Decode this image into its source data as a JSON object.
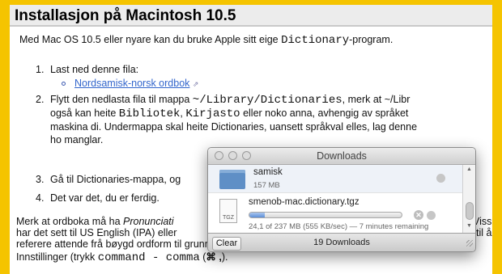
{
  "heading": "Installasjon på Macintosh 10.5",
  "intro": {
    "pre": "Med Mac OS 10.5 eller nyare kan du bruke Apple sitt eige ",
    "code": "Dictionary",
    "post": "-program."
  },
  "steps": {
    "n1": "1.",
    "s1": "Last ned denne fila:",
    "link": "Nordsamisk-norsk ordbok",
    "ext_icon": "external-link-icon",
    "n2": "2.",
    "s2a_pre": "Flytt den nedlasta fila til mappa ",
    "s2a_code": "~/Library/Dictionaries",
    "s2a_post": ", merk at ~/Libr",
    "s2b_pre": "også kan heite ",
    "s2b_code1": "Bibliotek",
    "s2b_sep": ", ",
    "s2b_code2": "Kirjasto",
    "s2b_post": " eller noko anna, avhengig av språket",
    "s2c": "maskina di. Undermappa skal heite Dictionaries, uansett språkval elles, lag denne",
    "s2d": "ho manglar.",
    "n3": "3.",
    "s3": "Gå til Dictionaries-mappa, og",
    "n4": "4.",
    "s4": "Det var det, du er ferdig."
  },
  "footer": {
    "l1_pre": "Merk at ordboka må ha ",
    "l1_em": "Pronunciati",
    "l1_tail": "Viss",
    "l2_pre": "har det sett til US English (IPA) eller",
    "l2_tail": "til å",
    "l3": "referere attende frå bøygd ordform til grunnform. Ottale (Pronunciation) er sett under",
    "l4_pre": "Innstillinger (trykk ",
    "l4_code": "command - comma",
    "l4_mid": " (",
    "l4_sym": "⌘ ,",
    "l4_post": ")."
  },
  "downloads": {
    "title": "Downloads",
    "items": [
      {
        "name": "samisk",
        "size": "157 MB",
        "icon": "folder-icon"
      },
      {
        "name": "smenob-mac.dictionary.tgz",
        "status": "24,1 of 237 MB (555 KB/sec) — 7 minutes remaining",
        "icon_label": "TGZ",
        "progress": 0.102
      }
    ],
    "clear_label": "Clear",
    "count": "19 Downloads"
  }
}
